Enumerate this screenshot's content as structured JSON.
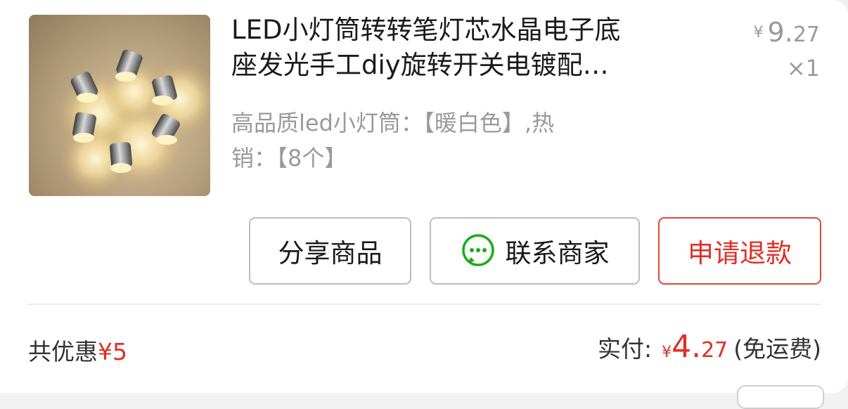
{
  "product": {
    "title_line1": "LED小灯筒转转笔灯芯水晶电子底",
    "title_line2": "座发光手工diy旋转开关电镀配…",
    "spec_line1": "高品质led小灯筒：【暖白色】,热",
    "spec_line2": "销：【8个】",
    "price": {
      "currency": "¥",
      "integer": "9.",
      "decimal": "27"
    },
    "quantity": "×1",
    "image_icon": "led-light-product-photo"
  },
  "actions": {
    "share_label": "分享商品",
    "contact_label": "联系商家",
    "contact_icon": "wechat-chat-icon",
    "refund_label": "申请退款"
  },
  "summary": {
    "discount_label": "共优惠",
    "discount_value": "¥5",
    "paid_label": "实付:",
    "paid_currency": "¥",
    "paid_integer": "4.",
    "paid_decimal": "27",
    "shipping_note": "(免运费)"
  },
  "colors": {
    "accent_red": "#e02e24",
    "wechat_green": "#1aad19",
    "muted_text": "#9a9a9a"
  }
}
